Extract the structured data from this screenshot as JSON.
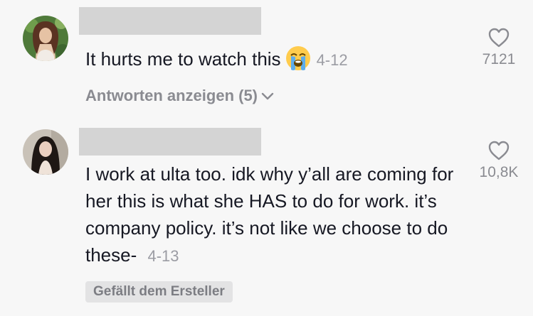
{
  "comments": [
    {
      "text": "It hurts me to watch this",
      "emoji": "loudly-crying-face-emoji",
      "date": "4-12",
      "like_count": "7121",
      "replies_label": "Antworten anzeigen (5)"
    },
    {
      "text": "I work at ulta too. idk why y’all are coming for her this is what she HAS to do for work. it’s company policy. it’s not like we choose to do these-",
      "date": "4-13",
      "like_count": "10,8K",
      "badge": "Gefällt dem Ersteller"
    }
  ],
  "colors": {
    "background": "#f7f7f7",
    "text": "#161823",
    "secondary_text": "#8a8b91",
    "redaction": "#d4d4d4",
    "badge_bg": "#e3e3e4"
  }
}
